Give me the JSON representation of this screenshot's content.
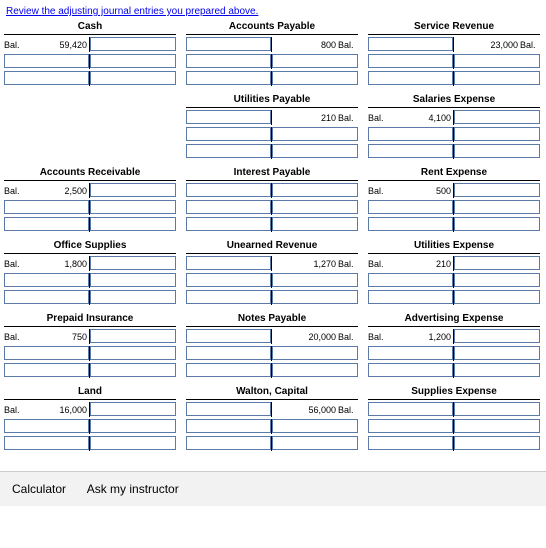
{
  "link_text": "Review the adjusting journal entries you prepared above.",
  "accounts": {
    "cash": {
      "title": "Cash",
      "bal_label": "Bal.",
      "bal_amt": "59,420",
      "side": "debit"
    },
    "ap": {
      "title": "Accounts Payable",
      "bal_label": "Bal.",
      "bal_amt": "800",
      "side": "credit"
    },
    "svc_rev": {
      "title": "Service Revenue",
      "bal_label": "Bal.",
      "bal_amt": "23,000",
      "side": "credit"
    },
    "util_pay": {
      "title": "Utilities Payable",
      "bal_label": "Bal.",
      "bal_amt": "210",
      "side": "credit"
    },
    "sal_exp": {
      "title": "Salaries Expense",
      "bal_label": "Bal.",
      "bal_amt": "4,100",
      "side": "debit"
    },
    "ar": {
      "title": "Accounts Receivable",
      "bal_label": "Bal.",
      "bal_amt": "2,500",
      "side": "debit"
    },
    "int_pay": {
      "title": "Interest Payable",
      "bal_label": "",
      "bal_amt": "",
      "side": "none"
    },
    "rent_exp": {
      "title": "Rent Expense",
      "bal_label": "Bal.",
      "bal_amt": "500",
      "side": "debit"
    },
    "off_supp": {
      "title": "Office Supplies",
      "bal_label": "Bal.",
      "bal_amt": "1,800",
      "side": "debit"
    },
    "unearn": {
      "title": "Unearned Revenue",
      "bal_label": "Bal.",
      "bal_amt": "1,270",
      "side": "credit"
    },
    "util_exp": {
      "title": "Utilities Expense",
      "bal_label": "Bal.",
      "bal_amt": "210",
      "side": "debit"
    },
    "prepaid": {
      "title": "Prepaid Insurance",
      "bal_label": "Bal.",
      "bal_amt": "750",
      "side": "debit"
    },
    "notes_pay": {
      "title": "Notes Payable",
      "bal_label": "Bal.",
      "bal_amt": "20,000",
      "side": "credit"
    },
    "adv_exp": {
      "title": "Advertising Expense",
      "bal_label": "Bal.",
      "bal_amt": "1,200",
      "side": "debit"
    },
    "land": {
      "title": "Land",
      "bal_label": "Bal.",
      "bal_amt": "16,000",
      "side": "debit"
    },
    "capital": {
      "title": "Walton, Capital",
      "bal_label": "Bal.",
      "bal_amt": "56,000",
      "side": "credit"
    },
    "supp_exp": {
      "title": "Supplies Expense",
      "bal_label": "",
      "bal_amt": "",
      "side": "none"
    }
  },
  "footer": {
    "calc": "Calculator",
    "ask": "Ask my instructor"
  }
}
